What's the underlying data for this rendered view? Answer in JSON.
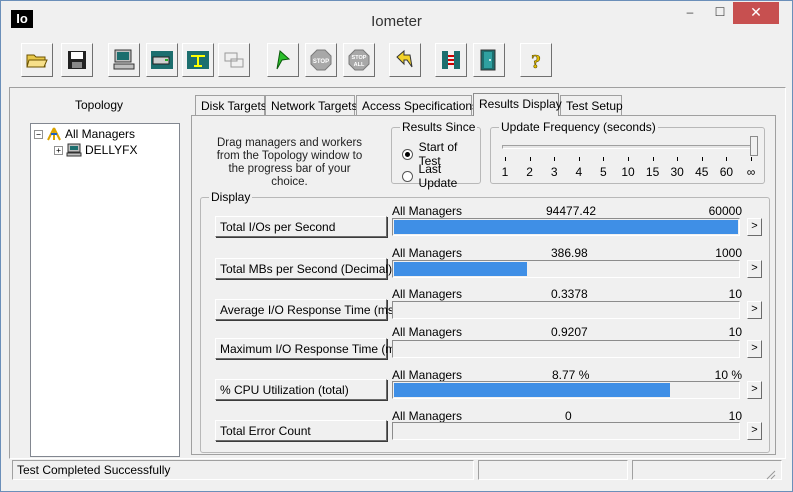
{
  "window": {
    "title": "Iometer",
    "app_icon_text": "Io",
    "controls": {
      "minimize": "–",
      "maximize": "☐",
      "close": "✕"
    }
  },
  "toolbar": {
    "buttons": [
      {
        "name": "open-config-button",
        "icon": "folder-open-icon"
      },
      {
        "name": "save-config-button",
        "icon": "floppy-disk-icon"
      },
      {
        "name": "start-new-manager-button",
        "icon": "computer-icon"
      },
      {
        "name": "start-new-disk-worker-button",
        "icon": "disk-worker-icon"
      },
      {
        "name": "start-new-network-worker-button",
        "icon": "network-worker-icon"
      },
      {
        "name": "duplicate-worker-button",
        "icon": "copy-worker-icon"
      },
      {
        "name": "start-tests-button",
        "icon": "green-flag-icon"
      },
      {
        "name": "stop-button",
        "icon": "stop-sign-icon",
        "text": "STOP"
      },
      {
        "name": "stop-all-button",
        "icon": "stop-all-sign-icon",
        "text": "STOP ALL"
      },
      {
        "name": "reset-workers-button",
        "icon": "reset-arrow-icon"
      },
      {
        "name": "disconnect-button",
        "icon": "disconnect-icon"
      },
      {
        "name": "exit-button",
        "icon": "exit-door-icon"
      },
      {
        "name": "about-button",
        "icon": "question-mark-icon",
        "text": "?"
      }
    ]
  },
  "topology": {
    "title": "Topology",
    "root": "All Managers",
    "children": [
      "DELLYFX"
    ]
  },
  "tabs": [
    {
      "label": "Disk Targets"
    },
    {
      "label": "Network Targets"
    },
    {
      "label": "Access Specifications"
    },
    {
      "label": "Results Display",
      "active": true
    },
    {
      "label": "Test Setup"
    }
  ],
  "results": {
    "hint": "Drag managers and workers from the Topology window to the progress bar of your choice.",
    "results_since": {
      "label": "Results Since",
      "options": [
        {
          "label": "Start of Test",
          "selected": true
        },
        {
          "label": "Last Update",
          "selected": false
        }
      ]
    },
    "update_frequency": {
      "label": "Update Frequency (seconds)",
      "ticks": [
        "1",
        "2",
        "3",
        "4",
        "5",
        "10",
        "15",
        "30",
        "45",
        "60",
        "∞"
      ],
      "selected": "∞"
    },
    "display_label": "Display",
    "rows": [
      {
        "button": "Total I/Os per Second",
        "scope": "All Managers",
        "value": "94477.42",
        "max": "60000",
        "fill": 1.0
      },
      {
        "button": "Total MBs per Second (Decimal)",
        "scope": "All Managers",
        "value": "386.98",
        "max": "1000",
        "fill": 0.387
      },
      {
        "button": "Average I/O Response Time (ms)",
        "scope": "All Managers",
        "value": "0.3378",
        "max": "10",
        "fill": 0.0
      },
      {
        "button": "Maximum I/O Response Time (ms)",
        "scope": "All Managers",
        "value": "0.9207",
        "max": "10",
        "fill": 0.0
      },
      {
        "button": "% CPU Utilization (total)",
        "scope": "All Managers",
        "value": "8.77 %",
        "max": "10 %",
        "fill": 0.802
      },
      {
        "button": "Total Error Count",
        "scope": "All Managers",
        "value": "0",
        "max": "10",
        "fill": 0.0
      }
    ],
    "arrow": ">",
    "bar_color": "#3f8fe6"
  },
  "status": {
    "message": "Test Completed Successfully",
    "panels": [
      "",
      ""
    ]
  }
}
